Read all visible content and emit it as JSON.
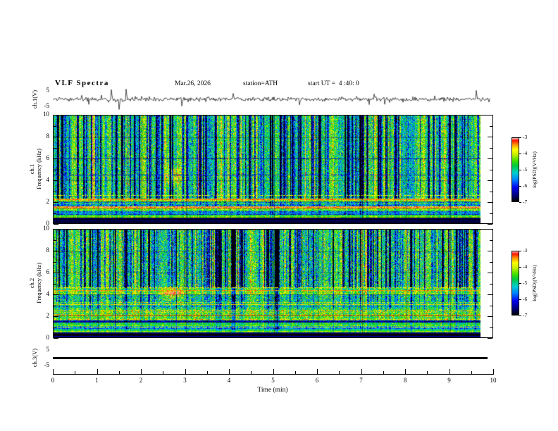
{
  "header": {
    "title": "VLF  Spectra",
    "date": "Mar.26, 2026",
    "station": "station=ATH",
    "start_ut": "start UT =  4 :40: 0"
  },
  "axes": {
    "time_label": "Time  (min)",
    "time_ticks": [
      "0",
      "1",
      "2",
      "3",
      "4",
      "5",
      "6",
      "7",
      "8",
      "9",
      "10"
    ],
    "time_range": [
      0,
      10
    ],
    "data_end_min": 9.7,
    "freq_ticks": [
      "10",
      "8",
      "6",
      "4",
      "2",
      "0"
    ],
    "wave_yticks": [
      "5",
      "-5"
    ],
    "ch3_yticks": [
      "5",
      "-5"
    ],
    "ch1_wave": {
      "label": "ch.1(V)"
    },
    "ch1_spec": {
      "label_ch": "ch.1",
      "label_freq": "Frequency (kHz)"
    },
    "ch2_spec": {
      "label_ch": "ch.2",
      "label_freq": "Frequency (kHz)"
    },
    "ch3": {
      "label": "ch.3(V)"
    }
  },
  "colorbar": {
    "label": "log(PSD)(V²/Hz)",
    "ticks": [
      "-3",
      "-4",
      "-5",
      "-6",
      "-7"
    ],
    "value_range": [
      -7,
      -3
    ],
    "stops": [
      {
        "t": 0.0,
        "hex": "#000000"
      },
      {
        "t": 0.1,
        "hex": "#000080"
      },
      {
        "t": 0.22,
        "hex": "#0000ee"
      },
      {
        "t": 0.34,
        "hex": "#0080ff"
      },
      {
        "t": 0.45,
        "hex": "#00d0d0"
      },
      {
        "t": 0.56,
        "hex": "#00c840"
      },
      {
        "t": 0.64,
        "hex": "#40e000"
      },
      {
        "t": 0.74,
        "hex": "#c8f000"
      },
      {
        "t": 0.82,
        "hex": "#ffff00"
      },
      {
        "t": 0.9,
        "hex": "#ff8c00"
      },
      {
        "t": 0.96,
        "hex": "#ff1400"
      },
      {
        "t": 1.0,
        "hex": "#ffb4b4"
      }
    ]
  },
  "chart_data": [
    {
      "type": "line",
      "name": "ch1-waveform",
      "xlabel": "Time (min)",
      "ylabel": "ch.1(V)",
      "x_range": [
        0,
        9.95
      ],
      "y_range": [
        -5,
        5
      ],
      "baseline": 0,
      "noise_std": 0.5,
      "small_spike_prob": 0.012,
      "small_spike_amp": 2.2,
      "spikes": [
        {
          "t": 1.32,
          "a": 4.6
        },
        {
          "t": 1.5,
          "a": -4.8
        },
        {
          "t": 1.66,
          "a": 5.0
        },
        {
          "t": 2.92,
          "a": -3.2
        },
        {
          "t": 4.1,
          "a": 2.8
        },
        {
          "t": 5.6,
          "a": -2.6
        },
        {
          "t": 7.3,
          "a": 2.5
        },
        {
          "t": 9.62,
          "a": 4.2
        }
      ],
      "seed": 1234
    },
    {
      "type": "heatmap",
      "name": "ch1-spectrogram",
      "xlabel": "Time (min)",
      "ylabel": "ch.1 Frequency (kHz)",
      "x_range": [
        0,
        9.7
      ],
      "y_range": [
        0,
        10
      ],
      "value_range": [
        -7,
        -3
      ],
      "seed": 77,
      "bands": [
        {
          "khz": [
            0,
            0.55
          ],
          "v": -6.95,
          "n": 0.05,
          "s": 0.0
        },
        {
          "khz": [
            0.55,
            0.8
          ],
          "v": -4.5,
          "n": 0.25,
          "s": 0.15
        },
        {
          "khz": [
            0.8,
            1.1
          ],
          "v": -5.5,
          "n": 0.35,
          "s": 0.2
        },
        {
          "khz": [
            1.1,
            1.35
          ],
          "v": -4.4,
          "n": 0.3,
          "s": 0.2
        },
        {
          "khz": [
            1.35,
            1.55
          ],
          "v": -3.6,
          "n": 0.35,
          "s": 0.15
        },
        {
          "khz": [
            1.55,
            2.05
          ],
          "v": -5.15,
          "n": 0.5,
          "s": 0.3
        },
        {
          "khz": [
            2.05,
            2.3
          ],
          "v": -3.85,
          "n": 0.45,
          "s": 0.2
        },
        {
          "khz": [
            2.3,
            10
          ],
          "v": -4.85,
          "n": 0.5,
          "s": 1.0
        }
      ],
      "lines": [
        {
          "khz": 1.45,
          "v": -3.25,
          "gap": 0.05
        },
        {
          "khz": 2.2,
          "v": -3.35,
          "gap": 0.1
        },
        {
          "khz": 2.62,
          "v": -3.8,
          "gap": 0.35
        },
        {
          "khz": 4.5,
          "v": -6.2,
          "gap": 0.25
        },
        {
          "khz": 6.0,
          "v": -6.2,
          "gap": 0.3
        }
      ],
      "streaks": {
        "neg_count": 150,
        "neg_strength": [
          0.7,
          2.0
        ],
        "pos_count": 40,
        "pos_strength": [
          0.5,
          1.2
        ]
      },
      "blobs": [
        {
          "t": 2.72,
          "khz": 4.4,
          "rt": 0.15,
          "rkhz": 0.8,
          "dv": 1.2
        }
      ]
    },
    {
      "type": "heatmap",
      "name": "ch2-spectrogram",
      "xlabel": "Time (min)",
      "ylabel": "ch.2 Frequency (kHz)",
      "x_range": [
        0,
        9.7
      ],
      "y_range": [
        0,
        10
      ],
      "value_range": [
        -7,
        -3
      ],
      "seed": 913,
      "bands": [
        {
          "khz": [
            0,
            0.45
          ],
          "v": -6.95,
          "n": 0.05,
          "s": 0.0
        },
        {
          "khz": [
            0.45,
            0.75
          ],
          "v": -4.5,
          "n": 0.25,
          "s": 0.15
        },
        {
          "khz": [
            0.75,
            1.05
          ],
          "v": -5.3,
          "n": 0.35,
          "s": 0.2
        },
        {
          "khz": [
            1.05,
            1.35
          ],
          "v": -4.5,
          "n": 0.3,
          "s": 0.2
        },
        {
          "khz": [
            1.35,
            1.6
          ],
          "v": -6.4,
          "n": 0.3,
          "s": 0.1
        },
        {
          "khz": [
            1.6,
            2.05
          ],
          "v": -4.6,
          "n": 0.45,
          "s": 0.3
        },
        {
          "khz": [
            2.05,
            2.6
          ],
          "v": -4.15,
          "n": 0.5,
          "s": 0.3
        },
        {
          "khz": [
            2.6,
            3.25
          ],
          "v": -4.5,
          "n": 0.5,
          "s": 0.4
        },
        {
          "khz": [
            3.25,
            4.0
          ],
          "v": -4.9,
          "n": 0.55,
          "s": 0.5
        },
        {
          "khz": [
            4.0,
            4.6
          ],
          "v": -4.2,
          "n": 0.45,
          "s": 0.4
        },
        {
          "khz": [
            4.6,
            10
          ],
          "v": -4.8,
          "n": 0.55,
          "s": 1.0
        }
      ],
      "lines": [
        {
          "khz": 0.98,
          "v": -3.8,
          "gap": 0.3
        },
        {
          "khz": 2.12,
          "v": -3.3,
          "gap": 0.1
        },
        {
          "khz": 2.5,
          "v": -3.5,
          "gap": 0.2
        },
        {
          "khz": 3.08,
          "v": -3.6,
          "gap": 0.25
        },
        {
          "khz": 4.35,
          "v": -3.4,
          "gap": 0.15
        },
        {
          "khz": 4.62,
          "v": -3.7,
          "gap": 0.3
        }
      ],
      "streaks": {
        "neg_count": 170,
        "neg_strength": [
          0.9,
          2.2
        ],
        "pos_count": 30,
        "pos_strength": [
          0.5,
          1.0
        ]
      },
      "blobs": [
        {
          "t": 2.7,
          "khz": 4.1,
          "rt": 0.2,
          "rkhz": 0.55,
          "dv": 1.6
        }
      ]
    },
    {
      "type": "line",
      "name": "ch3-flatline",
      "xlabel": "Time (min)",
      "ylabel": "ch.3(V)",
      "x_range": [
        0,
        9.85
      ],
      "y_range": [
        -5,
        5
      ],
      "constant": 0
    }
  ]
}
